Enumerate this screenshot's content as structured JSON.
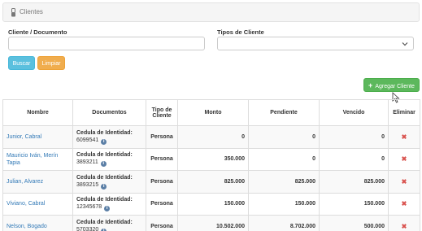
{
  "panel": {
    "title": "Clientes",
    "icon": "user-icon"
  },
  "search": {
    "client_label": "Cliente / Documento",
    "client_value": "",
    "type_label": "Tipos de Cliente",
    "type_value": ""
  },
  "buttons": {
    "buscar": "Buscar",
    "limpiar": "Limpiar",
    "agregar": "Agregar Cliente",
    "agregar_icon": "plus-icon"
  },
  "table": {
    "headers": {
      "nombre": "Nombre",
      "documentos": "Documentos",
      "tipo": "Tipo de Cliente",
      "monto": "Monto",
      "pendiente": "Pendiente",
      "vencido": "Vencido",
      "eliminar": "Eliminar"
    },
    "rows": [
      {
        "nombre": "Junior, Cabral",
        "doc_label": "Cedula de Identidad:",
        "doc_number": "6099541",
        "tipo": "Persona",
        "monto": "0",
        "pendiente": "0",
        "vencido": "0",
        "delete": "✖"
      },
      {
        "nombre": "Mauricio Iván, Merín Tapia",
        "doc_label": "Cedula de Identidad:",
        "doc_number": "3893211",
        "tipo": "Persona",
        "monto": "350.000",
        "pendiente": "0",
        "vencido": "0",
        "delete": "✖"
      },
      {
        "nombre": "Julian, Alvarez",
        "doc_label": "Cedula de Identidad:",
        "doc_number": "3893215",
        "tipo": "Persona",
        "monto": "825.000",
        "pendiente": "825.000",
        "vencido": "825.000",
        "delete": "✖"
      },
      {
        "nombre": "Viviano, Cabral",
        "doc_label": "Cedula de Identidad:",
        "doc_number": "12345678",
        "tipo": "Persona",
        "monto": "150.000",
        "pendiente": "150.000",
        "vencido": "150.000",
        "delete": "✖"
      },
      {
        "nombre": "Nelson, Bogado",
        "doc_label": "Cedula de Identidad:",
        "doc_number": "5703320",
        "tipo": "Persona",
        "monto": "10.502.000",
        "pendiente": "8.702.000",
        "vencido": "500.000",
        "delete": "✖"
      }
    ]
  },
  "colors": {
    "link": "#337ab7",
    "info": "#5bc0de",
    "warning": "#f0ad4e",
    "success": "#5cb85c",
    "danger": "#d9534f"
  }
}
